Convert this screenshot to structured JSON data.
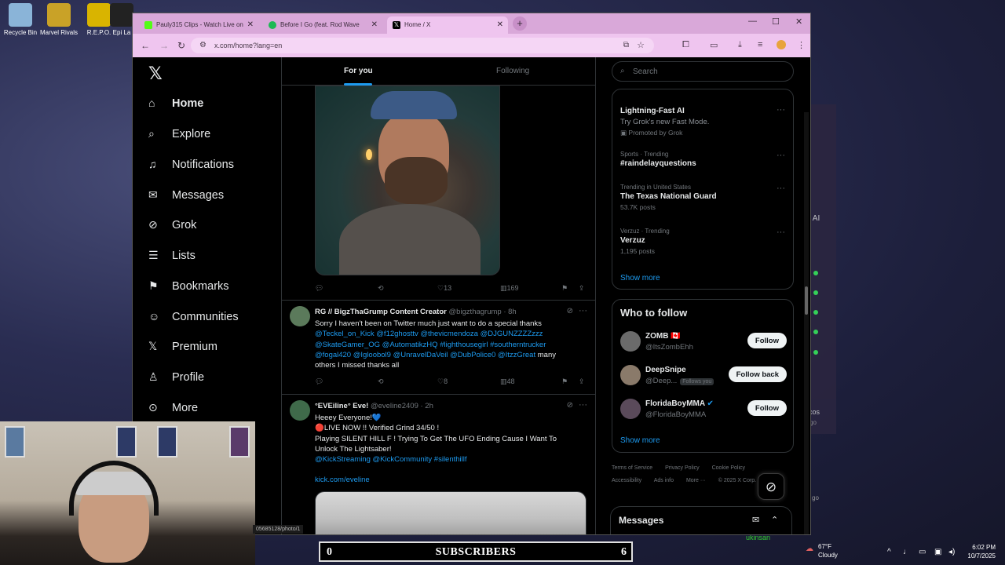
{
  "desktop": {
    "icons": [
      {
        "label": "Recycle Bin",
        "color": "#8ab4d8"
      },
      {
        "label": "Marvel Rivals",
        "color": "#c9a227"
      },
      {
        "label": "R.E.P.O.",
        "color": "#d9b400"
      },
      {
        "label": "Epi La",
        "color": "#222222"
      }
    ],
    "right_labels": {
      "ai": "e AI",
      "acos": "acos",
      "go1": "go",
      "go2": "go",
      "kinsan": "ukinsan"
    }
  },
  "browser": {
    "tabs": [
      {
        "label": "Pauly315 Clips - Watch Live on",
        "favicon_color": "#53fc18"
      },
      {
        "label": "Before I Go (feat. Rod Wave",
        "favicon_color": "#1db954"
      },
      {
        "label": "Home / X",
        "favicon_color": "#000000"
      }
    ],
    "url": "x.com/home?lang=en",
    "accent": "#d9a8d9"
  },
  "x": {
    "nav": [
      "Home",
      "Explore",
      "Notifications",
      "Messages",
      "Grok",
      "Lists",
      "Bookmarks",
      "Communities",
      "Premium",
      "Profile",
      "More"
    ],
    "feed_tabs": {
      "for_you": "For you",
      "following": "Following"
    },
    "post1_actions": {
      "likes": "13",
      "views": "169"
    },
    "post2": {
      "name": "RG // BigzThaGrump Content Creator",
      "handle": "@bigzthagrump",
      "time": "· 8h",
      "text_1": "Sorry I haven't been on Twitter much just want to do a special thanks",
      "mentions_1": "@Teckel_on_Kick @f12ghosttv @thevicmendoza @DJGUNZZZZzzz",
      "mentions_2": "@SkateGamer_OG @AutomatikzHQ #lighthousegirl #southerntrucker",
      "mentions_3": "@fogal420 @Igloobol9 @UnravelDaVeil @DubPolice0 @ItzzGreat",
      "text_2": "many",
      "text_3": "others I missed thanks all",
      "likes": "8",
      "views": "48"
    },
    "post3": {
      "name": "°EVEiline° Eve!",
      "handle": "@eveline2409",
      "time": "· 2h",
      "line1": "Heeey Everyone!💙",
      "line2": "🔴LIVE NOW !! Verified Grind  34/50 !",
      "line3": "Playing  SILENT HILL F ! Trying To Get The UFO Ending Cause I Want To",
      "line4": "Unlock The  Lightsaber!",
      "line5": "@KickStreaming @KickCommunity #silenthillf",
      "link": "kick.com/eveline"
    },
    "sidebar": {
      "search_placeholder": "Search",
      "promo": {
        "title": "Lightning-Fast AI",
        "sub": "Try Grok's new Fast Mode.",
        "promoted": "Promoted by Grok"
      },
      "trends": [
        {
          "meta": "Sports · Trending",
          "title": "#raindelayquestions",
          "sub": ""
        },
        {
          "meta": "Trending in United States",
          "title": "The Texas National Guard",
          "sub": "53.7K posts"
        },
        {
          "meta": "Verzuz · Trending",
          "title": "Verzuz",
          "sub": "1,195 posts"
        }
      ],
      "show_more": "Show more",
      "who_to_follow": "Who to follow",
      "follows": [
        {
          "name": "ZOMB 🇨🇦",
          "handle": "@ItsZombEhh",
          "button": "Follow",
          "tag": ""
        },
        {
          "name": "DeepSnipe",
          "handle": "@Deep...",
          "button": "Follow back",
          "tag": "Follows you"
        },
        {
          "name": "FloridaBoyMMA",
          "handle": "@FloridaBoyMMA",
          "button": "Follow",
          "tag": ""
        }
      ],
      "footer1": [
        "Terms of Service",
        "Privacy Policy",
        "Cookie Policy"
      ],
      "footer2": [
        "Accessibility",
        "Ads info",
        "More ···",
        "© 2025 X Corp."
      ],
      "messages": "Messages"
    }
  },
  "overlay": {
    "status_url": "05685128/photo/1",
    "subscribers": {
      "left": "0",
      "label": "SUBSCRIBERS",
      "right": "6"
    }
  },
  "taskbar": {
    "temp": "67°F",
    "weather": "Cloudy",
    "time": "6:02 PM",
    "date": "10/7/2025"
  }
}
